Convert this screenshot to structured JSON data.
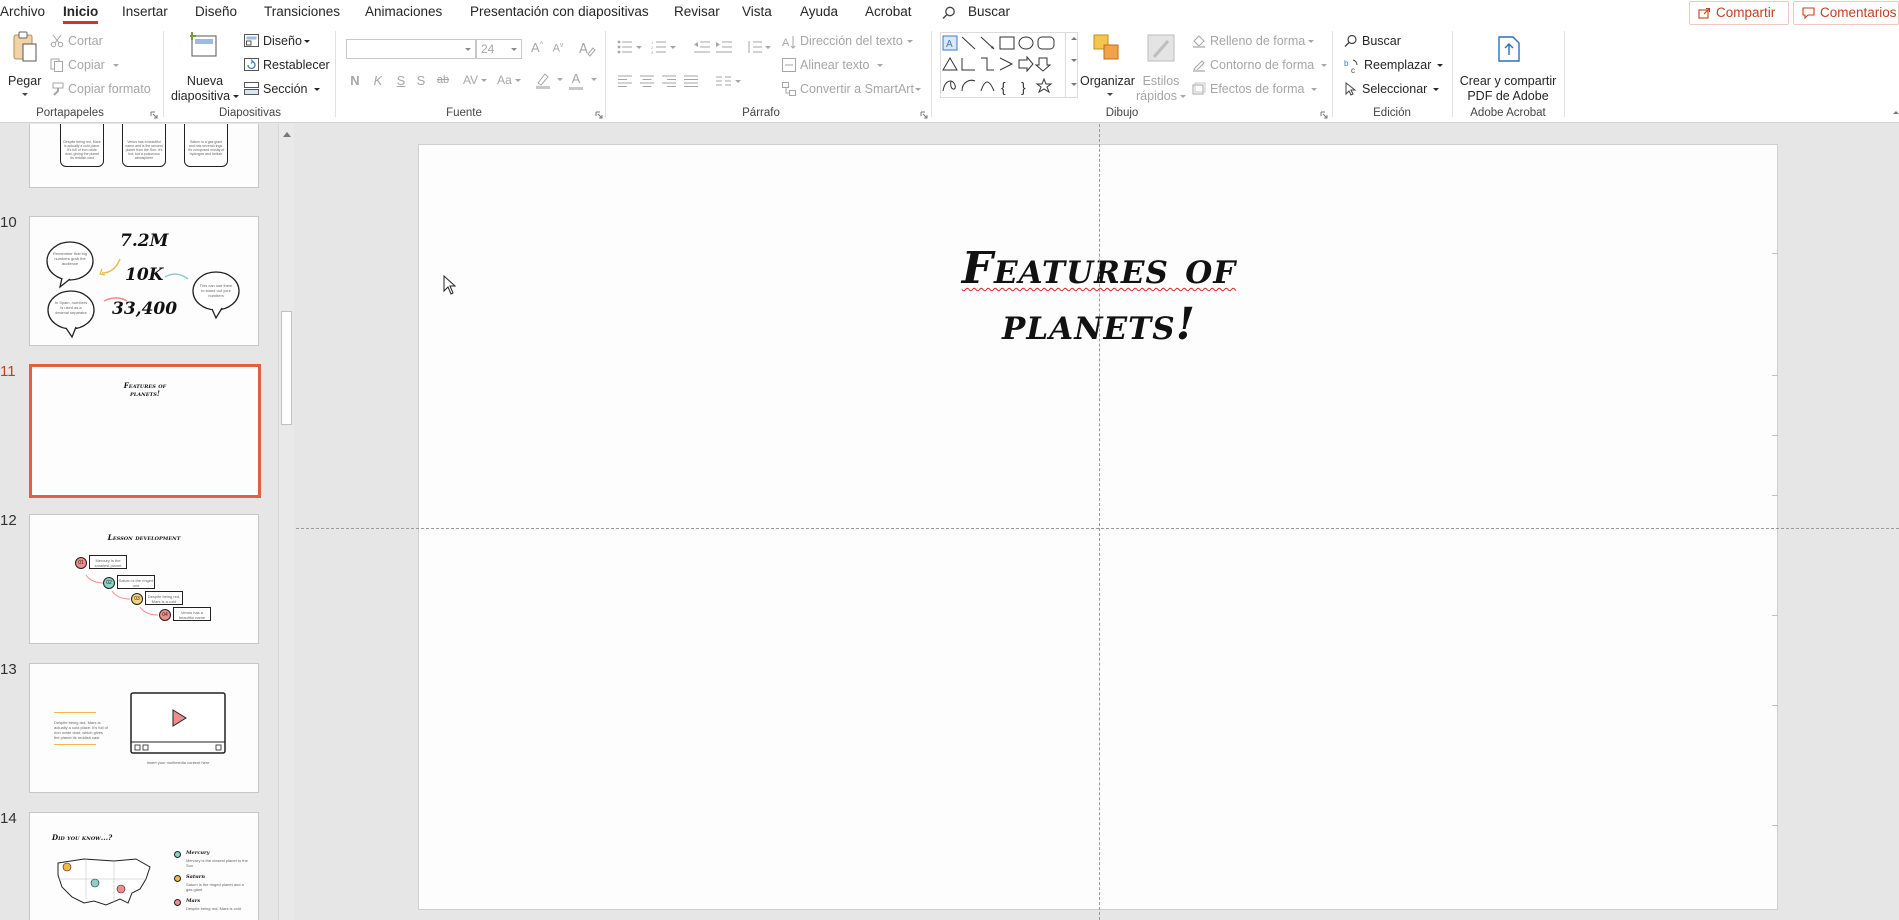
{
  "tabs": [
    "Archivo",
    "Inicio",
    "Insertar",
    "Diseño",
    "Transiciones",
    "Animaciones",
    "Presentación con diapositivas",
    "Revisar",
    "Vista",
    "Ayuda",
    "Acrobat"
  ],
  "search": {
    "label": "Buscar"
  },
  "share": {
    "label": "Compartir"
  },
  "comments": {
    "label": "Comentarios"
  },
  "ribbon": {
    "clipboard": {
      "label": "Portapapeles",
      "paste": "Pegar",
      "cut": "Cortar",
      "copy": "Copiar",
      "format_painter": "Copiar formato"
    },
    "slides": {
      "label": "Diapositivas",
      "new_slide_line1": "Nueva",
      "new_slide_line2": "diapositiva",
      "layout": "Diseño",
      "reset": "Restablecer",
      "section": "Sección"
    },
    "font": {
      "label": "Fuente",
      "font_name": "",
      "font_size": "24",
      "bold": "N",
      "italic": "K",
      "underline": "S",
      "shadow": "S",
      "strike": "ab",
      "spacing": "AV",
      "case": "Aa",
      "font_color": "A"
    },
    "paragraph": {
      "label": "Párrafo",
      "text_direction": "Dirección del texto",
      "align_text": "Alinear texto",
      "smartart": "Convertir a SmartArt"
    },
    "drawing": {
      "label": "Dibujo",
      "arrange": "Organizar",
      "quick_styles_line1": "Estilos",
      "quick_styles_line2": "rápidos",
      "shape_fill": "Relleno de forma",
      "shape_outline": "Contorno de forma",
      "shape_effects": "Efectos de forma"
    },
    "editing": {
      "label": "Edición",
      "find": "Buscar",
      "replace": "Reemplazar",
      "select": "Seleccionar"
    },
    "acrobat": {
      "label": "Adobe Acrobat",
      "create_line1": "Crear y compartir",
      "create_line2": "PDF de Adobe"
    }
  },
  "thumbnails": {
    "numbers": [
      "10",
      "11",
      "12",
      "13",
      "14"
    ],
    "s9": {
      "text1": "Despite being red, Mars is actually a cold place. It's full of iron oxide dust, giving the planet its reddish cast",
      "text2": "Venus has a beautiful name and is the second planet from the Sun. It's hot, but a poisonous atmosphere",
      "text3": "Saturn is a gas giant and has several rings. It's composed mostly of hydrogen and helium"
    },
    "s10": {
      "big1": "7.2M",
      "big2": "10K",
      "big3": "33,400",
      "text1": "Remember that big numbers grab the audience",
      "text2": "In Spain, numbers is used as a decimal separator",
      "text3": "This can use them to stand out your numbers"
    },
    "s11": {
      "title_line1": "Features of",
      "title_line2": "planets!"
    },
    "s12": {
      "title": "Lesson development",
      "n1": "01",
      "n2": "02",
      "n3": "03",
      "n4": "04",
      "text1": "Mercury is the smallest planet",
      "text2": "Saturn is the ringed one",
      "text3": "Despite being red, Mars is a cold",
      "text4": "Venus has a beautiful name"
    },
    "s13": {
      "text1": "Despite being red, Mars is actually a cold place. It's full of iron oxide dust, which gives the planet its reddish cast",
      "caption": "Insert your multimedia content here"
    },
    "s14": {
      "title": "Did you know...?",
      "h1": "Mercury",
      "t1": "Mercury is the closest planet to the Sun",
      "h2": "Saturn",
      "t2": "Saturn is the ringed planet and a gas giant",
      "h3": "Mars",
      "t3": "Despite being red, Mars is cold"
    }
  },
  "slide": {
    "title_line1": "Features of",
    "title_line2": "planets!"
  },
  "colors": {
    "accent": "#c43e1c",
    "selected_thumb": "#e1603f",
    "spell_squiggle": "#e02020"
  }
}
